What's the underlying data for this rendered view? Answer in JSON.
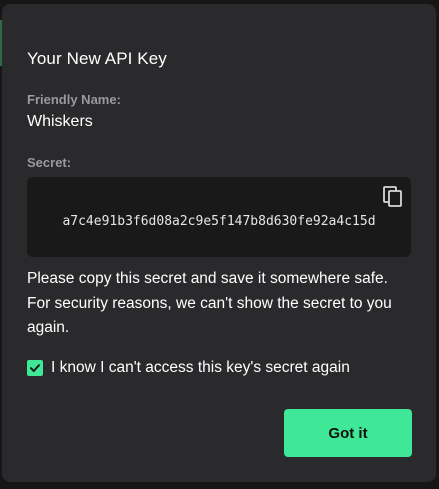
{
  "modal": {
    "title": "Your New API Key",
    "friendly_name_label": "Friendly Name:",
    "friendly_name_value": "Whiskers",
    "secret_label": "Secret:",
    "secret_value": "a7c4e91b3f6d08a2c9e5f147b8d630fe92a4c15d",
    "copy_icon": "copy-icon",
    "note": "Please copy this secret and save it somewhere safe. For security reasons, we can't show the secret to you again.",
    "acknowledge_label": "I know I can't access this key's secret again",
    "acknowledge_checked": true,
    "confirm_label": "Got it"
  },
  "colors": {
    "accent": "#3ee896",
    "modal_bg": "#2a2a2c",
    "secret_bg": "#19191a"
  }
}
